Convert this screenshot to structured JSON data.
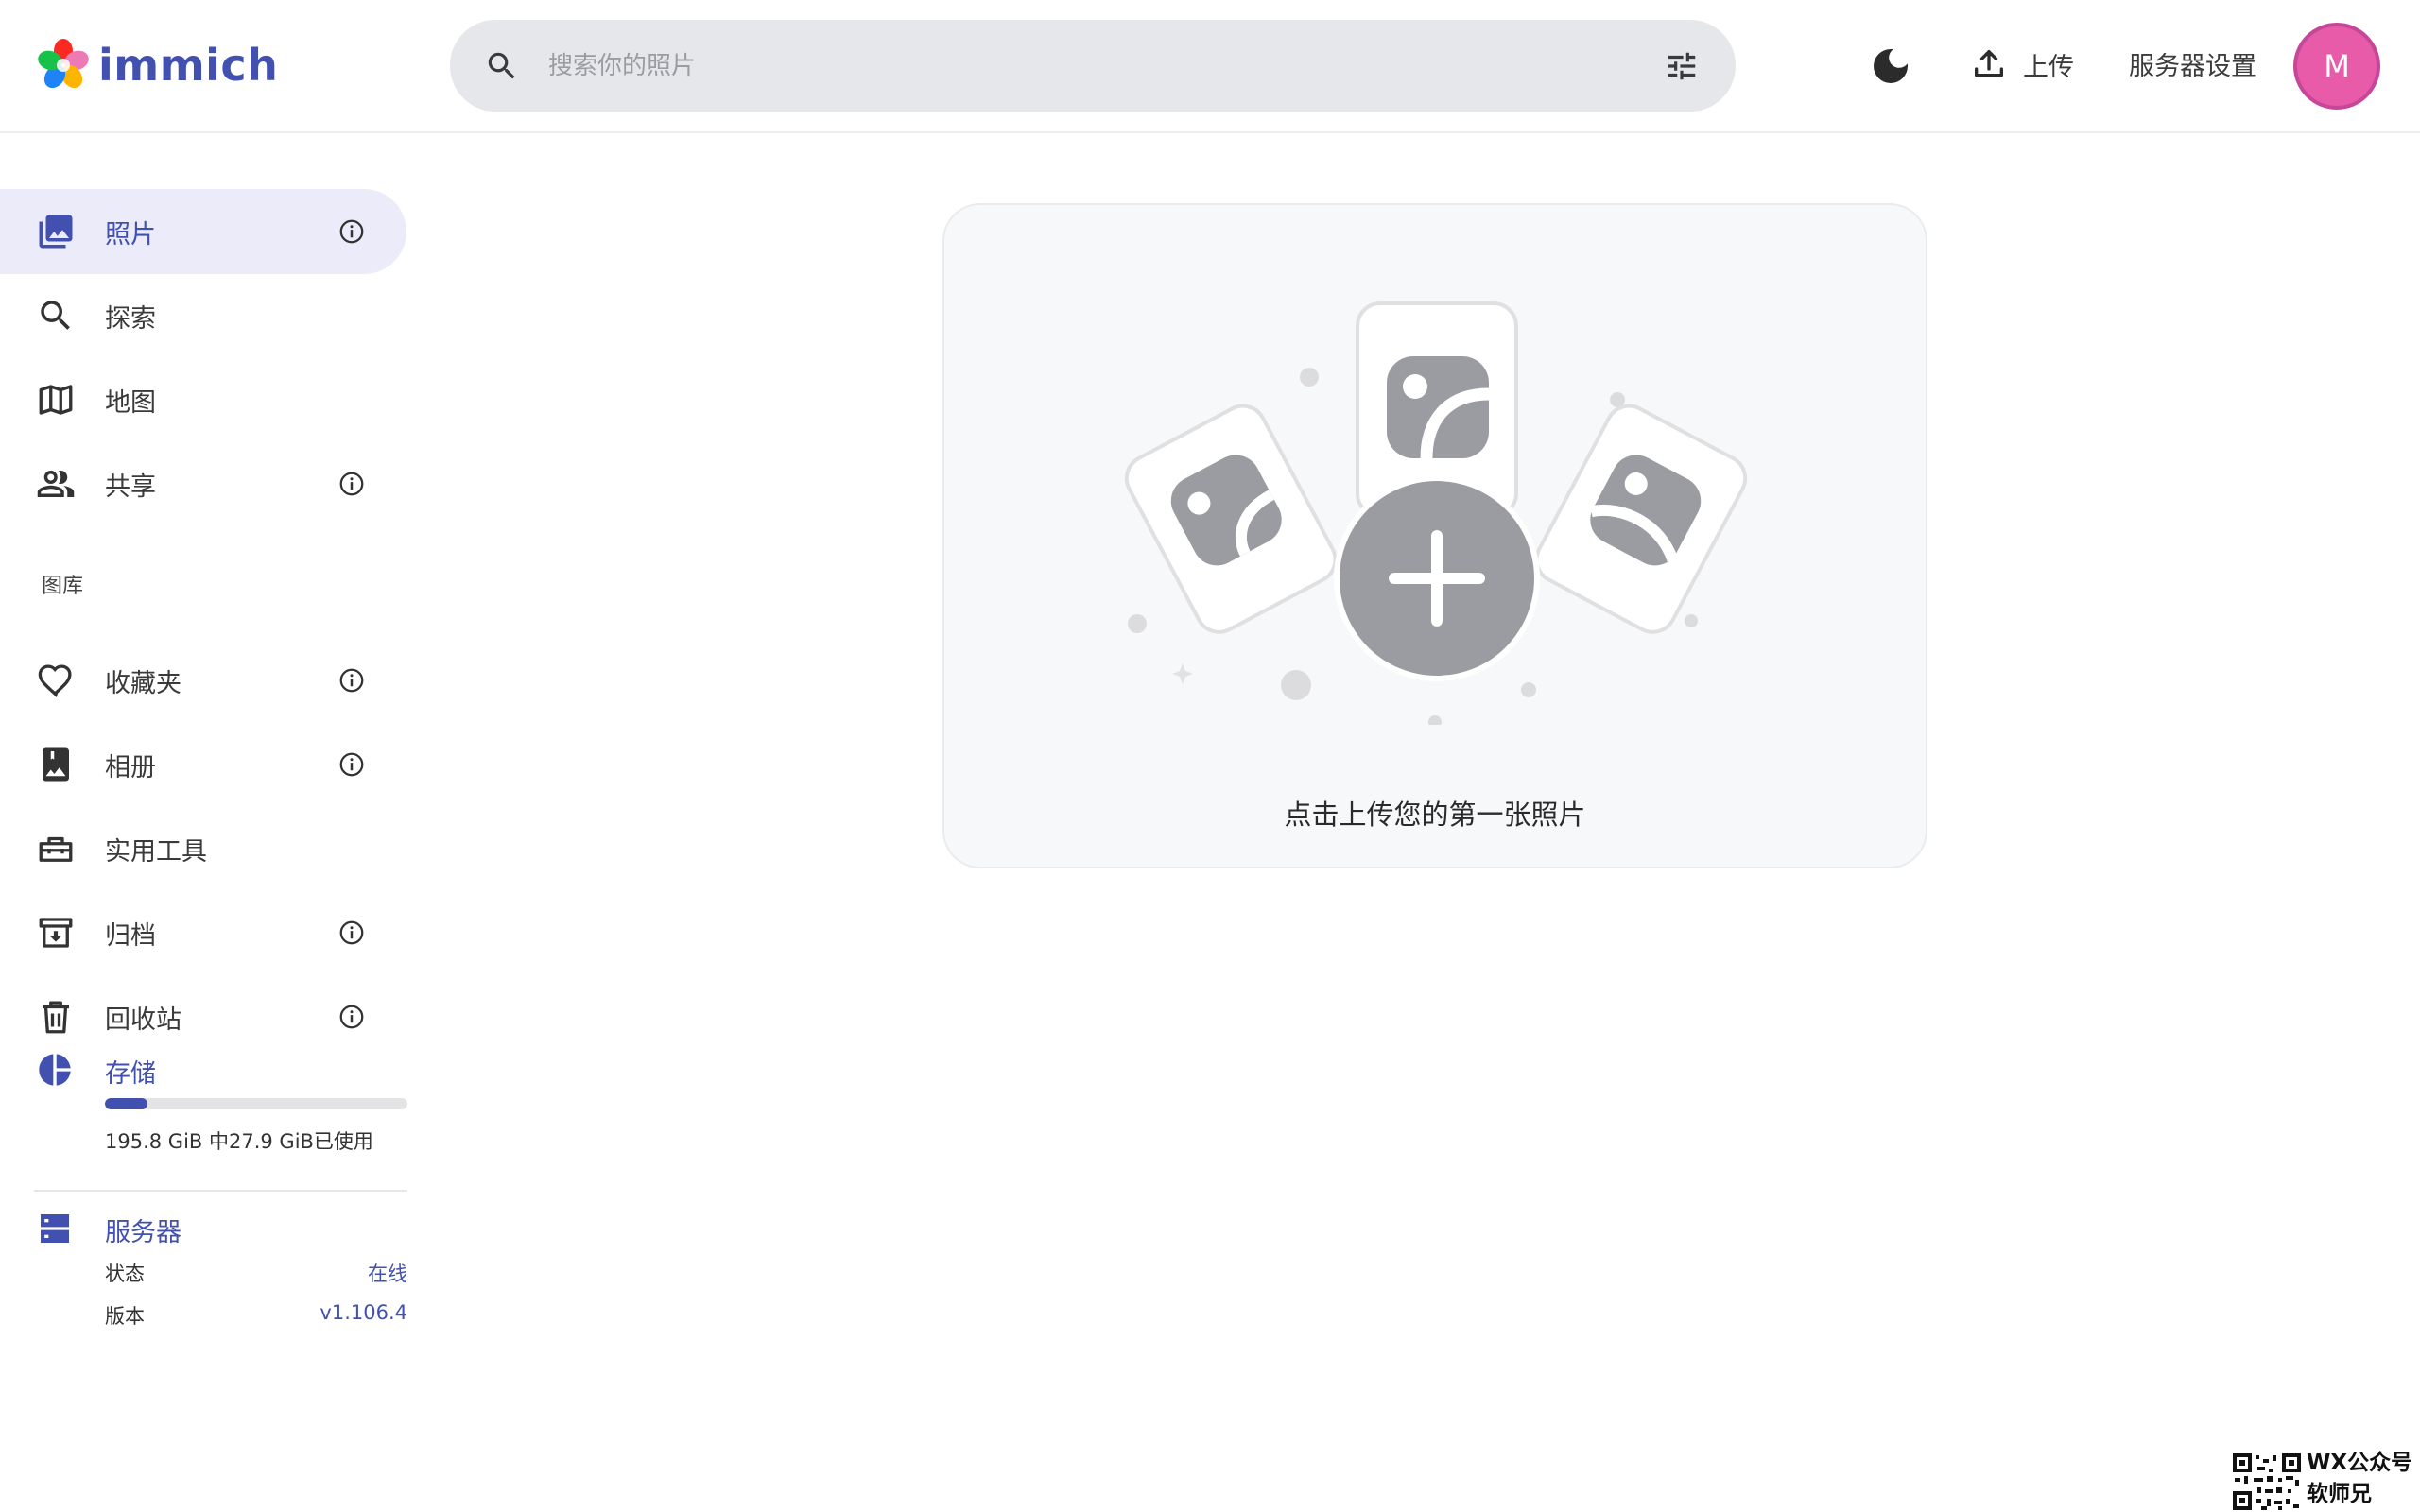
{
  "header": {
    "logo_text": "immich",
    "search_placeholder": "搜索你的照片",
    "upload_label": "上传",
    "server_settings_label": "服务器设置",
    "avatar_initial": "M"
  },
  "sidebar": {
    "items": [
      {
        "label": "照片",
        "icon": "photos-icon",
        "has_info": true,
        "active": true
      },
      {
        "label": "探索",
        "icon": "search-icon",
        "has_info": false
      },
      {
        "label": "地图",
        "icon": "map-icon",
        "has_info": false
      },
      {
        "label": "共享",
        "icon": "people-icon",
        "has_info": true
      }
    ],
    "library_section_label": "图库",
    "library_items": [
      {
        "label": "收藏夹",
        "icon": "heart-icon",
        "has_info": true
      },
      {
        "label": "相册",
        "icon": "album-icon",
        "has_info": true
      },
      {
        "label": "实用工具",
        "icon": "toolbox-icon",
        "has_info": false
      },
      {
        "label": "归档",
        "icon": "archive-icon",
        "has_info": true
      },
      {
        "label": "回收站",
        "icon": "trash-icon",
        "has_info": true
      }
    ],
    "storage": {
      "title": "存储",
      "usage_text": "195.8 GiB 中27.9 GiB已使用",
      "used_fraction": 0.142
    },
    "server": {
      "title": "服务器",
      "status_label": "状态",
      "status_value": "在线",
      "version_label": "版本",
      "version_value": "v1.106.4"
    }
  },
  "main": {
    "empty_message": "点击上传您的第一张照片"
  },
  "watermark": {
    "line1": "WX公众号",
    "line2": "软师兄"
  },
  "colors": {
    "accent": "#4250af",
    "active_bg": "#ebebfa",
    "avatar_bg": "#e85ba8",
    "search_bg": "#e6e7eb",
    "card_bg": "#f7f8f9"
  }
}
